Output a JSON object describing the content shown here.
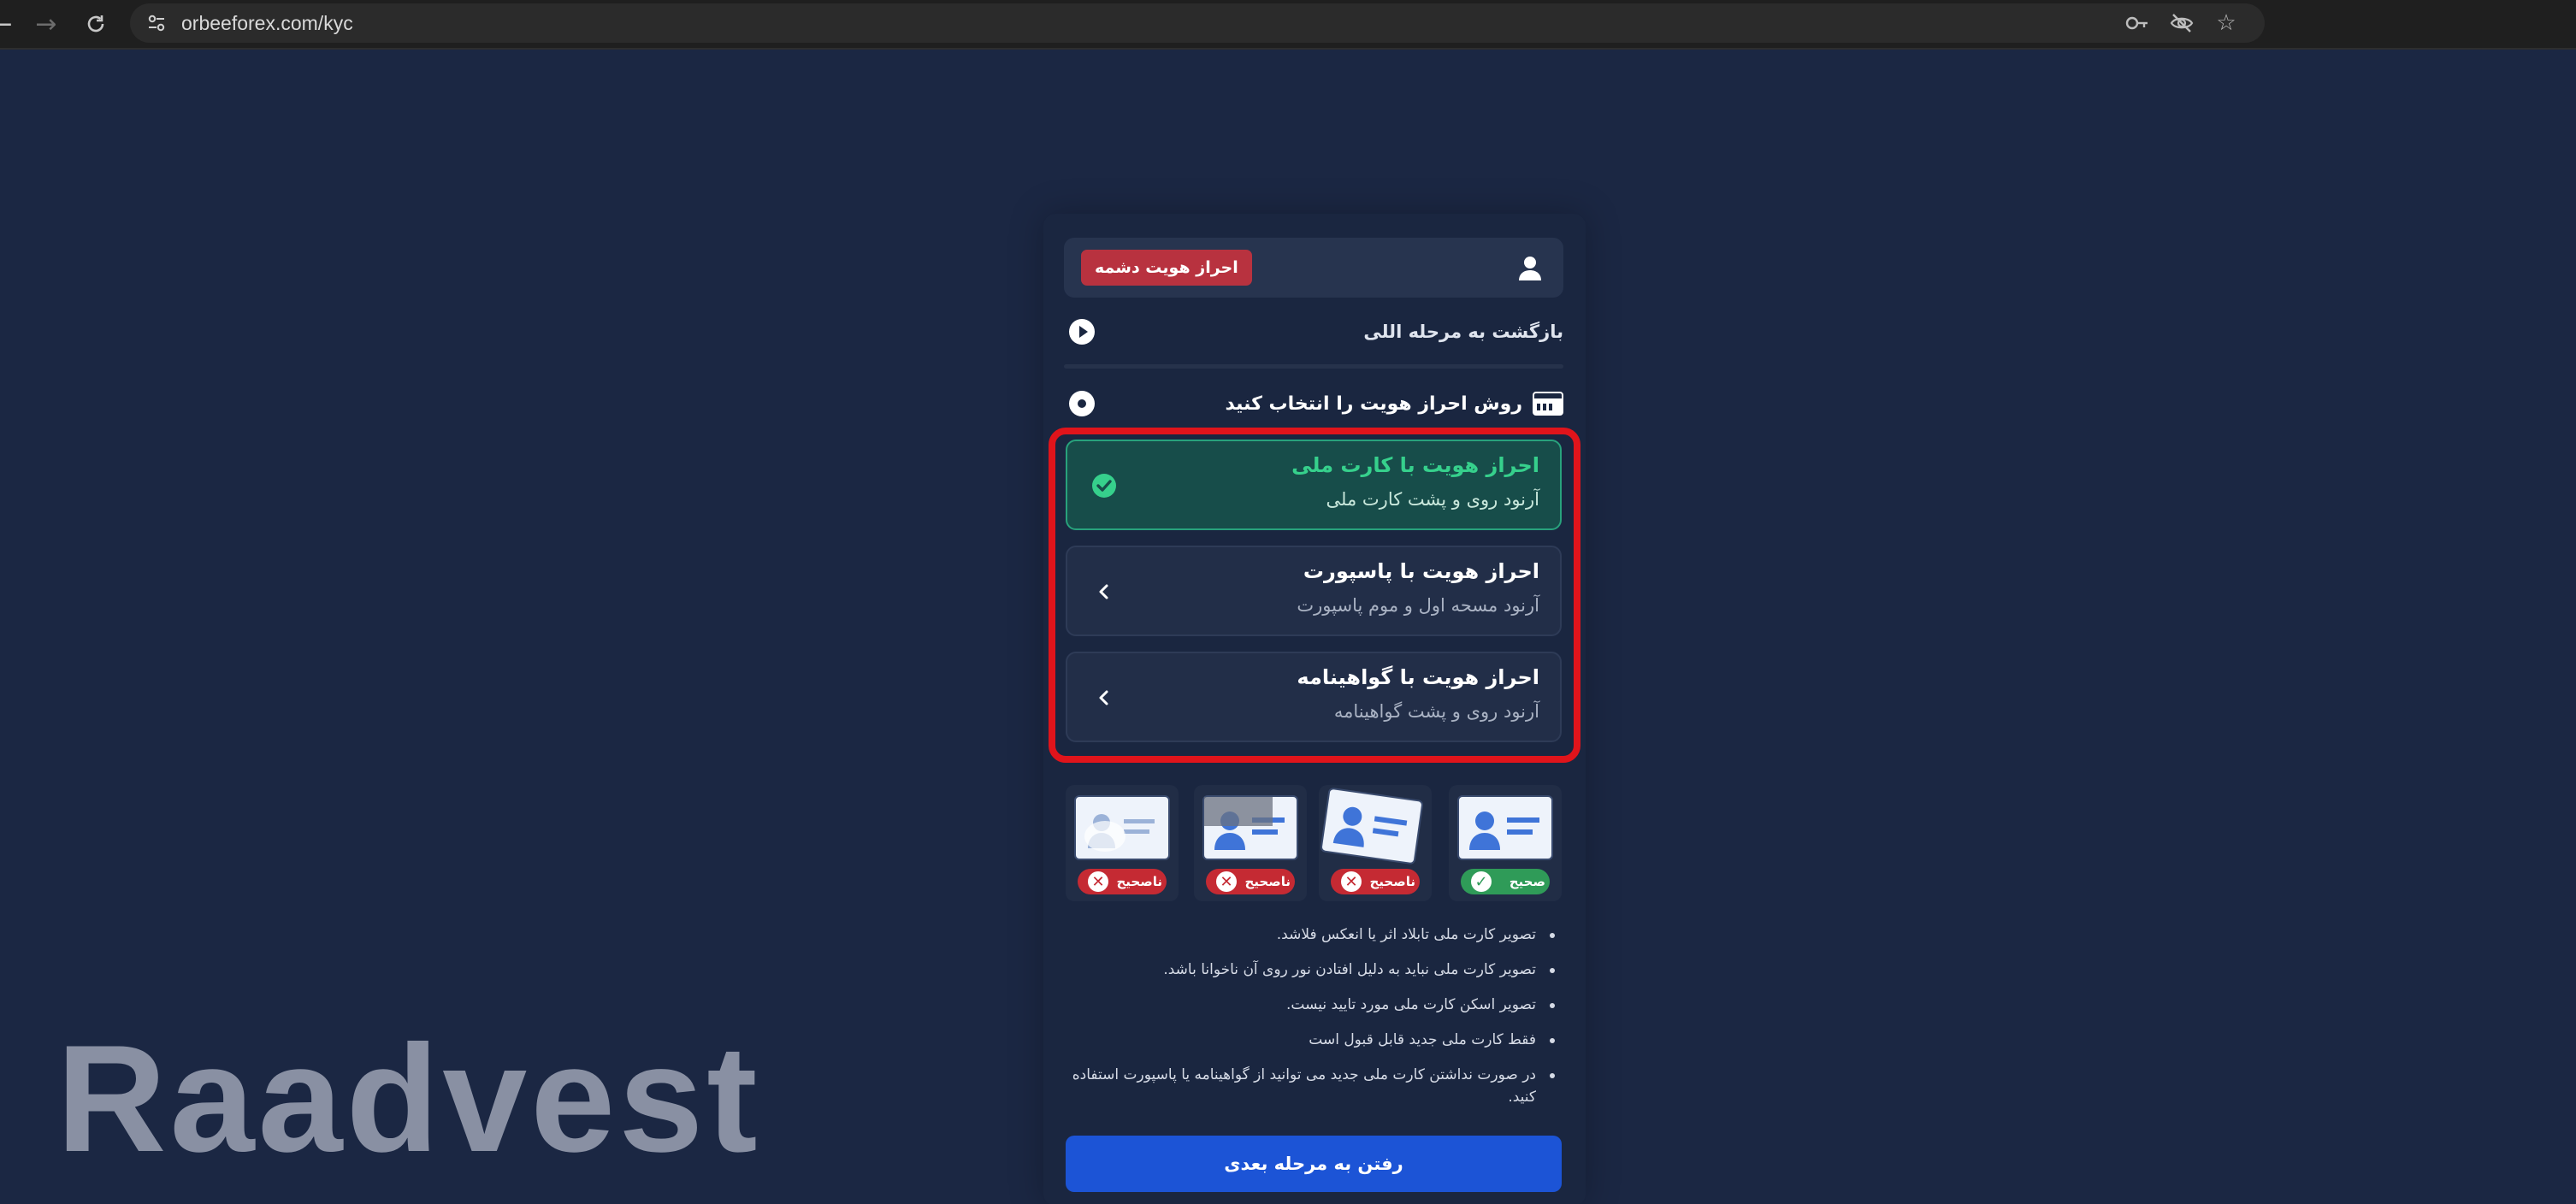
{
  "browser": {
    "url": "orbeeforex.com/kyc"
  },
  "panel": {
    "status_badge": "احراز هویت دشمه",
    "back_link": "بازگشت به مرحله اللی",
    "method_heading": "روش احراز هویت را انتخاب کنید",
    "options": [
      {
        "title": "احراز هویت با کارت ملی",
        "subtitle": "آرنود روی و پشت کارت ملی",
        "selected": true
      },
      {
        "title": "احراز هویت با پاسپورت",
        "subtitle": "آرنود مسحه اول و موم پاسپورت",
        "selected": false
      },
      {
        "title": "احراز هویت با گواهینامه",
        "subtitle": "آرنود روی و پشت گواهینامه",
        "selected": false
      }
    ],
    "samples": [
      {
        "label": "ناصحیح",
        "status": "bad"
      },
      {
        "label": "ناصحیح",
        "status": "bad"
      },
      {
        "label": "ناصحیح",
        "status": "bad"
      },
      {
        "label": "صحیح",
        "status": "good"
      }
    ],
    "rules": [
      "تصویر کارت ملی تابلاد اثر یا انعکس فلاشد.",
      "تصویر کارت ملی نباید به دلیل افتادن نور روی آن ناخوانا باشد.",
      "تصویر اسکن کارت ملی مورد تایید نیست.",
      "فقط کارت ملی جدید قابل قبول است",
      "در صورت نداشتن کارت ملی جدید می توانید از گواهینامه یا پاسپورت استفاده کنید."
    ],
    "next_button": "رفتن به مرحله بعدی"
  },
  "watermark": "Raadvest",
  "colors": {
    "page_bg": "#1b2743",
    "selected_green": "#36d08c",
    "highlight_red": "#e0141b",
    "primary_blue": "#1c54d6",
    "badge_red": "#b8323f"
  }
}
